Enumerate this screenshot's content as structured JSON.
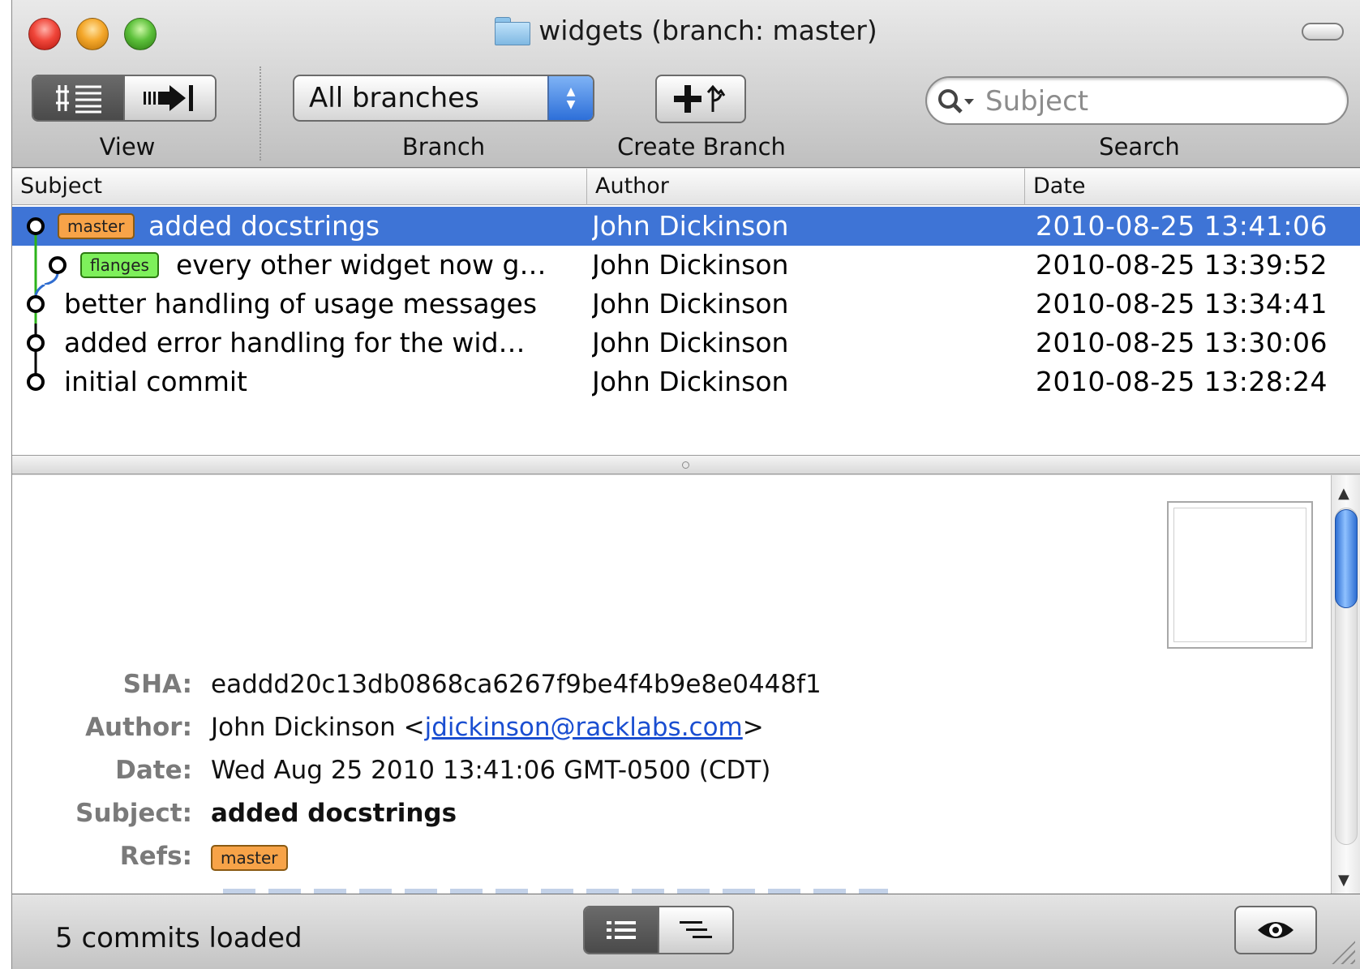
{
  "window": {
    "title": "widgets (branch: master)"
  },
  "toolbar": {
    "view_label": "View",
    "branch_label": "Branch",
    "branch_selected": "All branches",
    "create_branch_label": "Create Branch",
    "search_label": "Search",
    "search_placeholder": "Subject"
  },
  "table": {
    "headers": {
      "subject": "Subject",
      "author": "Author",
      "date": "Date"
    },
    "rows": [
      {
        "ref": "master",
        "subject": "added docstrings",
        "author": "John Dickinson",
        "date": "2010-08-25 13:41:06"
      },
      {
        "ref": "flanges",
        "subject": "every other widget now g…",
        "author": "John Dickinson",
        "date": "2010-08-25 13:39:52"
      },
      {
        "ref": "",
        "subject": "better handling of usage messages",
        "author": "John Dickinson",
        "date": "2010-08-25 13:34:41"
      },
      {
        "ref": "",
        "subject": "added error handling for the wid…",
        "author": "John Dickinson",
        "date": "2010-08-25 13:30:06"
      },
      {
        "ref": "",
        "subject": "initial commit",
        "author": "John Dickinson",
        "date": "2010-08-25 13:28:24"
      }
    ]
  },
  "details": {
    "sha_label": "SHA:",
    "sha": "eaddd20c13db0868ca6267f9be4f4b9e8e0448f1",
    "author_label": "Author:",
    "author_name": "John Dickinson <",
    "author_email": "jdickinson@racklabs.com",
    "author_close": ">",
    "date_label": "Date:",
    "date": "Wed Aug 25 2010 13:41:06 GMT-0500 (CDT)",
    "subject_label": "Subject:",
    "subject": "added docstrings",
    "refs_label": "Refs:",
    "ref": "master"
  },
  "statusbar": {
    "status": "5 commits loaded"
  },
  "colors": {
    "selection": "#3e74d6",
    "master_ref": "#f7a348",
    "flanges_ref": "#7ef05b",
    "link": "#1a4ed1"
  }
}
